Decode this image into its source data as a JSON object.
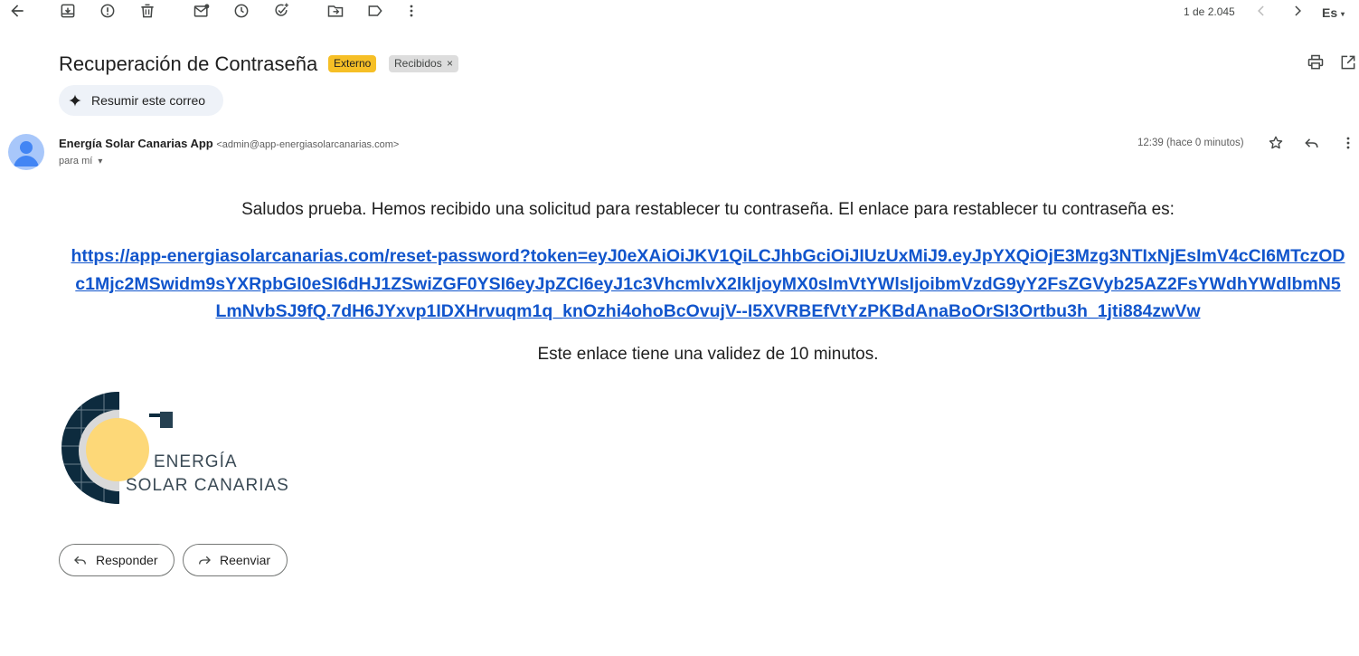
{
  "toolbar": {
    "pagination": "1 de 2.045",
    "language": "Es",
    "icons": [
      "arrow-back-icon",
      "archive-icon",
      "report-spam-icon",
      "delete-icon",
      "mark-unread-icon",
      "snooze-icon",
      "add-task-icon",
      "move-to-icon",
      "label-icon",
      "more-vert-icon",
      "chevron-left-icon",
      "chevron-right-icon"
    ]
  },
  "email": {
    "subject": "Recuperación de Contraseña",
    "labels": {
      "external": "Externo",
      "inbox": "Recibidos",
      "inbox_remove": "×"
    },
    "summarize_label": "Resumir este correo",
    "sender": {
      "name": "Energía Solar Canarias App",
      "address": "<admin@app-energiasolarcanarias.com>",
      "to": "para mí"
    },
    "time": "12:39 (hace 0 minutos)",
    "body": {
      "greeting": "Saludos prueba. Hemos recibido una solicitud para restablecer tu contraseña. El enlace para restablecer tu contraseña es:",
      "link": "https://app-energiasolarcanarias.com/reset-password?token=eyJ0eXAiOiJKV1QiLCJhbGciOiJIUzUxMiJ9.eyJpYXQiOjE3Mzg3NTIxNjEsImV4cCI6MTczODc1Mjc2MSwidm9sYXRpbGl0eSI6dHJ1ZSwiZGF0YSI6eyJpZCI6eyJ1c3VhcmlvX2lkIjoyMX0sImVtYWlsIjoibmVzdG9yY2FsZGVyb25AZ2FsYWdhYWdlbmN5LmNvbSJ9fQ.7dH6JYxvp1IDXHrvuqm1q_knOzhi4ohoBcOvujV--I5XVRBEfVtYzPKBdAnaBoOrSI3Ortbu3h_1jti884zwVw",
      "validity": "Este enlace tiene una validez de 10 minutos."
    },
    "logo": {
      "line1": "ENERGÍA",
      "line2": "SOLAR CANARIAS",
      "navy": "#0d2b3e",
      "sun": "#fdd878",
      "gray": "#d9d9d9"
    }
  },
  "actions": {
    "reply": "Responder",
    "forward": "Reenviar"
  },
  "colors": {
    "link": "#1155cc",
    "external_chip": "#f6bf26",
    "inbox_chip": "#dddddd",
    "summary_bg": "#eef2f8",
    "avatar": "#a8c7fa"
  }
}
